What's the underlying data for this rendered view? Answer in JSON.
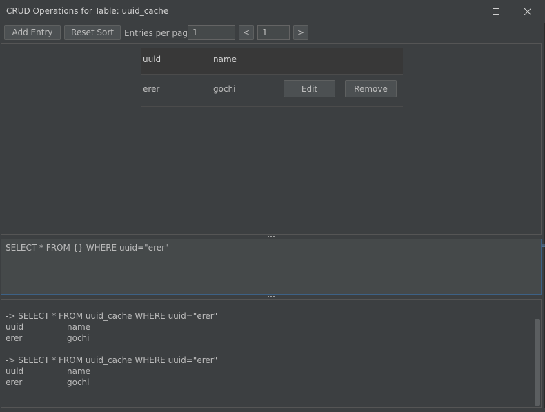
{
  "window": {
    "title": "CRUD Operations for Table: uuid_cache"
  },
  "toolbar": {
    "add_entry_label": "Add Entry",
    "reset_sort_label": "Reset Sort",
    "entries_per_page_label": "Entries per page:",
    "entries_per_page_value": "1",
    "prev_label": "<",
    "page_value": "1",
    "next_label": ">"
  },
  "table": {
    "columns": [
      "uuid",
      "name"
    ],
    "rows": [
      {
        "uuid": "erer",
        "name": "gochi",
        "edit_label": "Edit",
        "remove_label": "Remove"
      }
    ]
  },
  "query": {
    "text": "SELECT * FROM {} WHERE uuid=\"erer\""
  },
  "output": {
    "lines": [
      {
        "c1": "-> SELECT * FROM uuid_cache WHERE uuid=\"erer\"",
        "c2": ""
      },
      {
        "c1": "uuid",
        "c2": "name"
      },
      {
        "c1": "erer",
        "c2": "gochi"
      },
      {
        "c1": "",
        "c2": ""
      },
      {
        "c1": "-> SELECT * FROM uuid_cache WHERE uuid=\"erer\"",
        "c2": ""
      },
      {
        "c1": "uuid",
        "c2": "name"
      },
      {
        "c1": "erer",
        "c2": "gochi"
      }
    ]
  },
  "colors": {
    "background": "#3c3f41",
    "text": "#bbbbbb",
    "focus_border": "#3d6185"
  }
}
